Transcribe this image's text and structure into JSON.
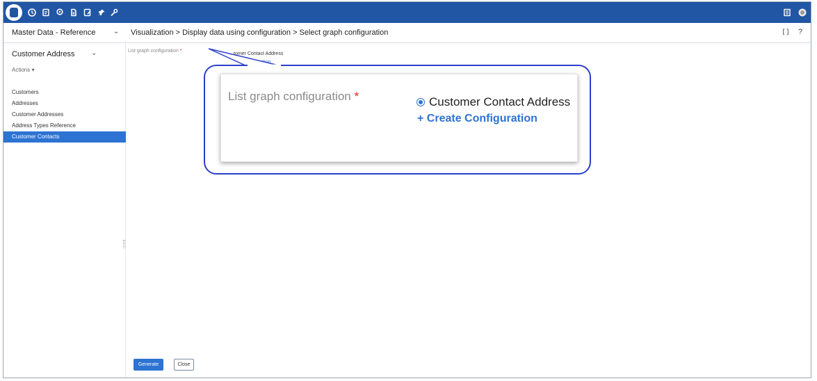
{
  "topbar": {
    "icons": [
      "database-icon",
      "clock-icon",
      "document-icon",
      "location-icon",
      "file-icon",
      "edit-document-icon",
      "pin-icon",
      "wrench-icon"
    ],
    "right_icons": [
      "list-icon",
      "user-avatar-icon"
    ]
  },
  "header": {
    "module": "Master Data - Reference",
    "breadcrumb": "Visualization > Display data using configuration > Select graph configuration",
    "expand_glyph": "[]",
    "help_glyph": "?"
  },
  "sidebar": {
    "title": "Customer Address",
    "actions_label": "Actions",
    "items": [
      {
        "label": "Customers",
        "active": false
      },
      {
        "label": "Addresses",
        "active": false
      },
      {
        "label": "Customer Addresses",
        "active": false
      },
      {
        "label": "Address Types Reference",
        "active": false
      },
      {
        "label": "Customer Contacts",
        "active": true
      }
    ]
  },
  "form": {
    "field_label": "List graph configuration",
    "required_mark": "*",
    "option_small": "tomer Contact Address",
    "create_small": "ration"
  },
  "callout": {
    "field_label": "List graph configuration",
    "required_mark": "*",
    "option_label": "Customer Contact Address",
    "create_label": "+ Create Configuration"
  },
  "footer": {
    "generate_label": "Generate",
    "close_label": "Close"
  },
  "colors": {
    "topbar": "#2156a5",
    "accent": "#2d73d2",
    "callout_border": "#2b3fc9",
    "required": "#dd2222"
  }
}
